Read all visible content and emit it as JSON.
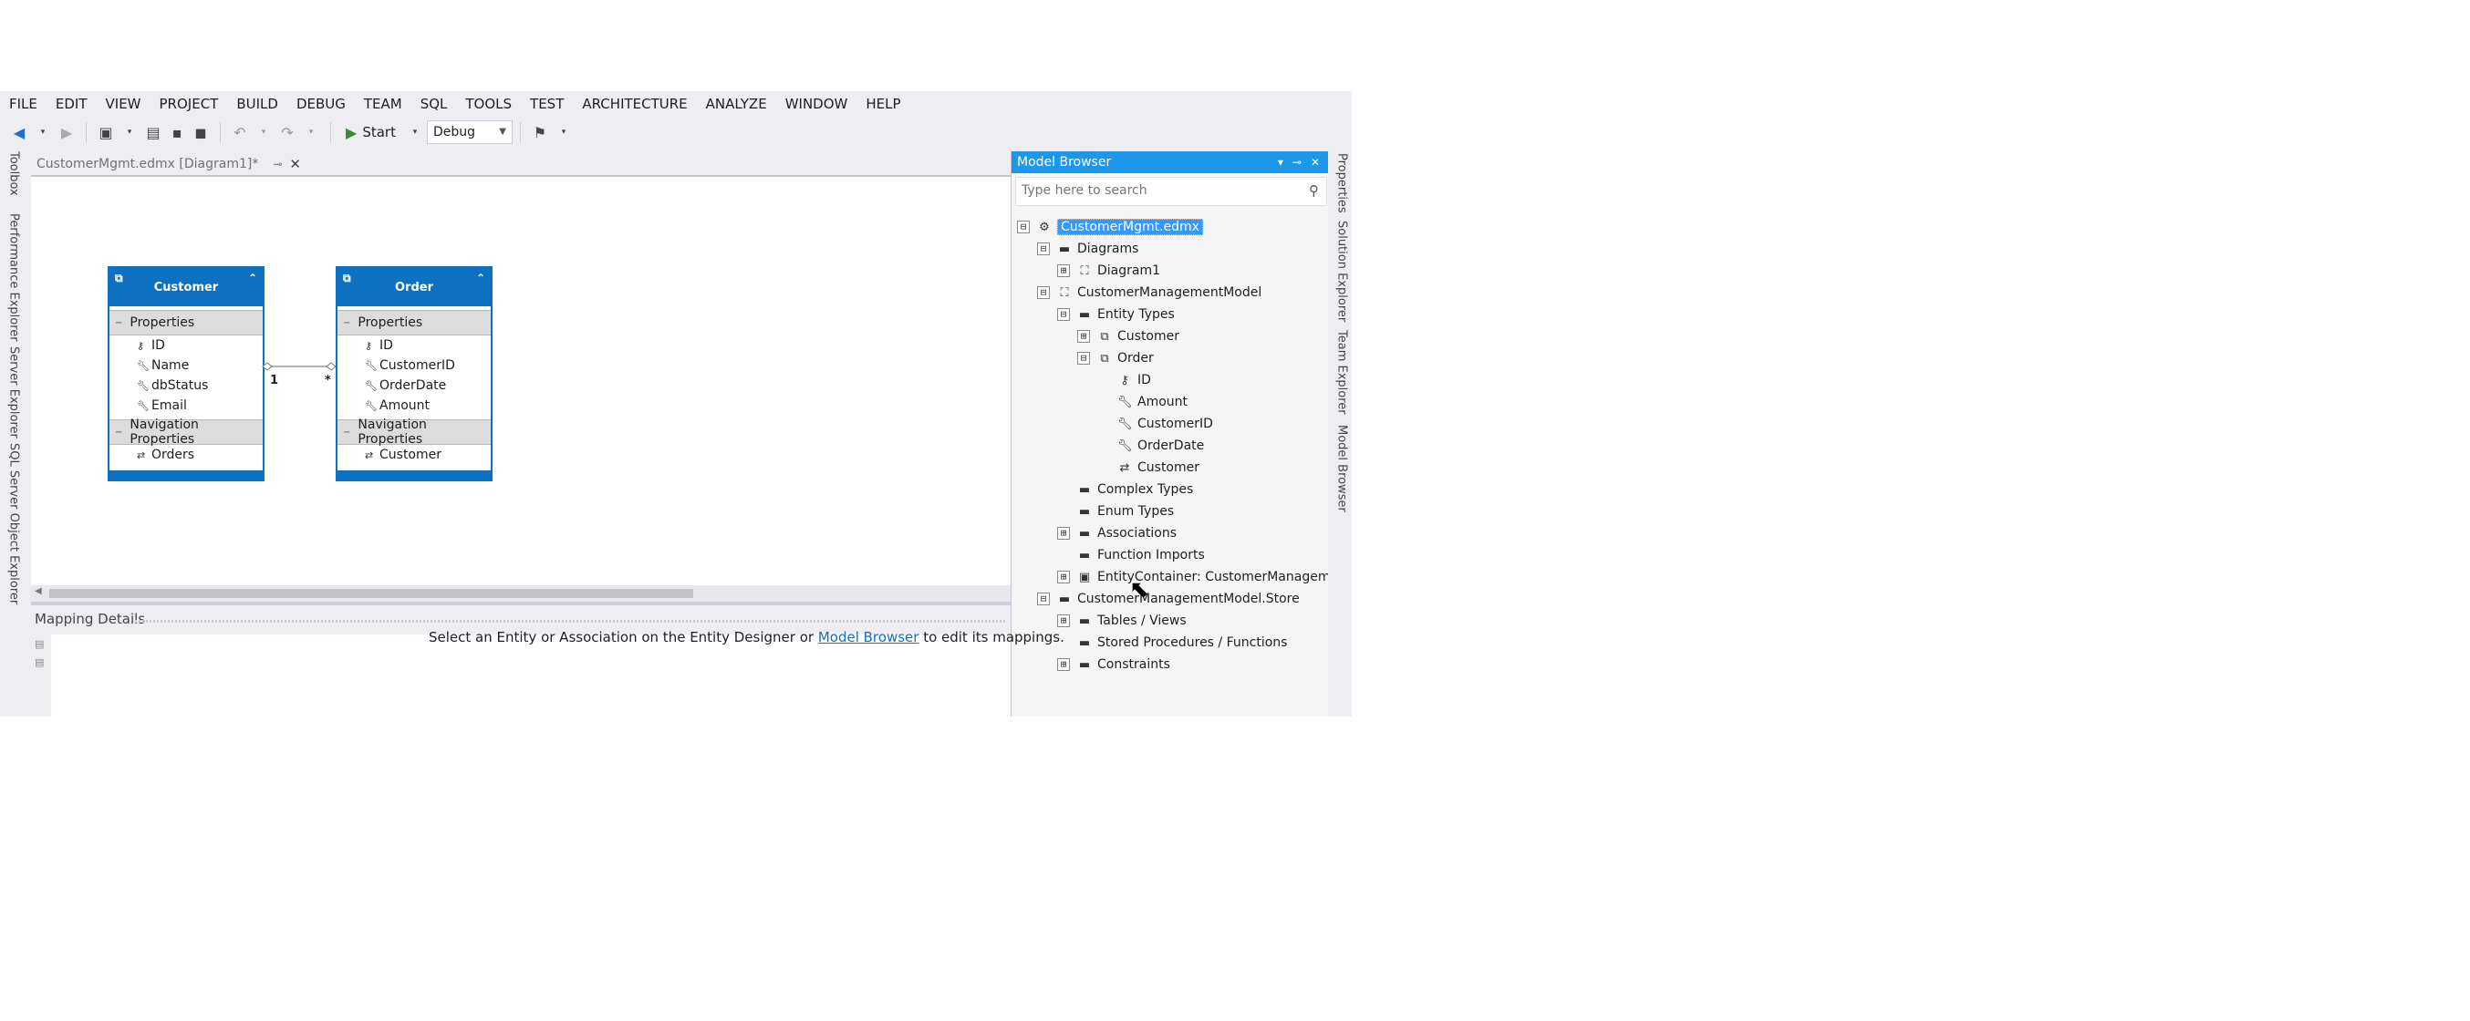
{
  "menu": [
    "FILE",
    "EDIT",
    "VIEW",
    "PROJECT",
    "BUILD",
    "DEBUG",
    "TEAM",
    "SQL",
    "TOOLS",
    "TEST",
    "ARCHITECTURE",
    "ANALYZE",
    "WINDOW",
    "HELP"
  ],
  "toolbar": {
    "start_label": "Start",
    "configuration": "Debug"
  },
  "left_rail": [
    "Toolbox",
    "Performance Explorer",
    "Server Explorer",
    "SQL Server Object Explorer"
  ],
  "document_tab": {
    "title": "CustomerMgmt.edmx [Diagram1]*"
  },
  "designer": {
    "entities": [
      {
        "name": "Customer",
        "section_properties": "Properties",
        "properties": [
          "ID",
          "Name",
          "dbStatus",
          "Email"
        ],
        "section_navigation": "Navigation Properties",
        "navigation": [
          "Orders"
        ]
      },
      {
        "name": "Order",
        "section_properties": "Properties",
        "properties": [
          "ID",
          "CustomerID",
          "OrderDate",
          "Amount"
        ],
        "section_navigation": "Navigation Properties",
        "navigation": [
          "Customer"
        ]
      }
    ],
    "association": {
      "left_multiplicity": "1",
      "right_multiplicity": "*"
    }
  },
  "mapping_details": {
    "title": "Mapping Details",
    "message_before": "Select an Entity or Association on the Entity Designer or ",
    "message_link": "Model Browser",
    "message_after": " to edit its mappings."
  },
  "model_browser": {
    "title": "Model Browser",
    "search_placeholder": "Type here to search",
    "tree": [
      {
        "label": "CustomerMgmt.edmx",
        "expander": "⊟"
      },
      {
        "label": "Diagrams",
        "expander": "⊟"
      },
      {
        "label": "Diagram1",
        "expander": "⊞"
      },
      {
        "label": "CustomerManagementModel",
        "expander": "⊟"
      },
      {
        "label": "Entity Types",
        "expander": "⊟"
      },
      {
        "label": "Customer",
        "expander": "⊞"
      },
      {
        "label": "Order",
        "expander": "⊟"
      },
      {
        "label": "ID"
      },
      {
        "label": "Amount"
      },
      {
        "label": "CustomerID"
      },
      {
        "label": "OrderDate"
      },
      {
        "label": "Customer"
      },
      {
        "label": "Complex Types"
      },
      {
        "label": "Enum Types"
      },
      {
        "label": "Associations",
        "expander": "⊞"
      },
      {
        "label": "Function Imports"
      },
      {
        "label": "EntityContainer: CustomerManagementEn",
        "expander": "⊞"
      },
      {
        "label": "CustomerManagementModel.Store",
        "expander": "⊟"
      },
      {
        "label": "Tables / Views",
        "expander": "⊞"
      },
      {
        "label": "Stored Procedures / Functions"
      },
      {
        "label": "Constraints",
        "expander": "⊞"
      }
    ]
  },
  "right_rail": [
    "Properties",
    "Solution Explorer",
    "Team Explorer",
    "Model Browser"
  ],
  "colors": {
    "entity_header": "#0e70c0",
    "panel_title": "#1c97ea",
    "selection": "#3399ff"
  }
}
